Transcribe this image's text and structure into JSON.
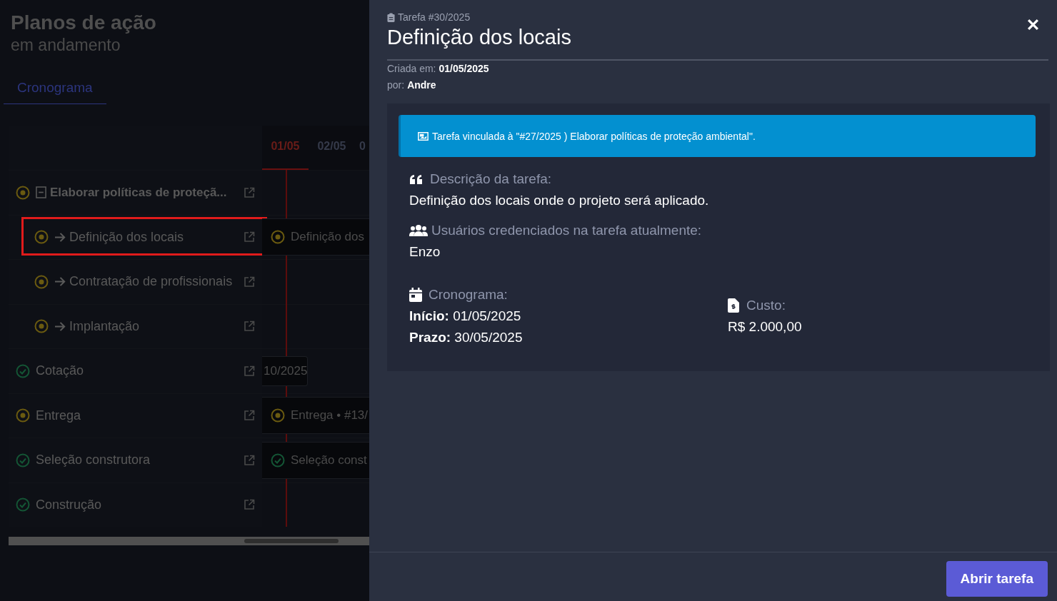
{
  "page": {
    "title": "Planos de ação",
    "subtitle": "em andamento"
  },
  "tabs": [
    {
      "label": "Cronograma",
      "selected": true
    }
  ],
  "gantt": {
    "dates": [
      {
        "label": "01/05",
        "today": true
      },
      {
        "label": "02/05",
        "today": false
      },
      {
        "label": "0",
        "today": false
      }
    ],
    "tasks": [
      {
        "name": "Elaborar políticas de proteçã...",
        "completed": false,
        "expanded": true,
        "highlighted": false,
        "children": [
          {
            "name": "Definição dos locais",
            "completed": false,
            "highlighted": true,
            "bar": {
              "label": "Definição dos",
              "completed": false
            }
          },
          {
            "name": "Contratação de profissionais",
            "completed": false,
            "highlighted": false
          },
          {
            "name": "Implantação",
            "completed": false,
            "highlighted": false
          }
        ]
      },
      {
        "name": "Cotação",
        "completed": true,
        "highlighted": false,
        "bar": {
          "label": "10/2025"
        }
      },
      {
        "name": "Entrega",
        "completed": false,
        "highlighted": false,
        "bar": {
          "label": "Entrega • #13/",
          "completed": false
        }
      },
      {
        "name": "Seleção construtora",
        "completed": true,
        "highlighted": false,
        "bar": {
          "label": "Seleção const",
          "completed": true
        }
      },
      {
        "name": "Construção",
        "completed": true,
        "highlighted": false
      }
    ]
  },
  "drawer": {
    "task_number": "Tarefa #30/2025",
    "title": "Definição dos locais",
    "created_label": "Criada em:",
    "created_value": "01/05/2025",
    "by_label": "por:",
    "by_value": "Andre",
    "alert": "Tarefa vinculada à \"#27/2025 ) Elaborar políticas de proteção ambiental\".",
    "description_label": "Descrição da tarefa:",
    "description": "Definição dos locais onde o projeto será aplicado.",
    "users_label": "Usuários credenciados na tarefa atualmente:",
    "users": "Enzo",
    "schedule_label": "Cronograma:",
    "start_label": "Início:",
    "start_value": "01/05/2025",
    "deadline_label": "Prazo:",
    "deadline_value": "30/05/2025",
    "cost_label": "Custo:",
    "cost_value": "R$ 2.000,00",
    "button": "Abrir tarefa"
  }
}
